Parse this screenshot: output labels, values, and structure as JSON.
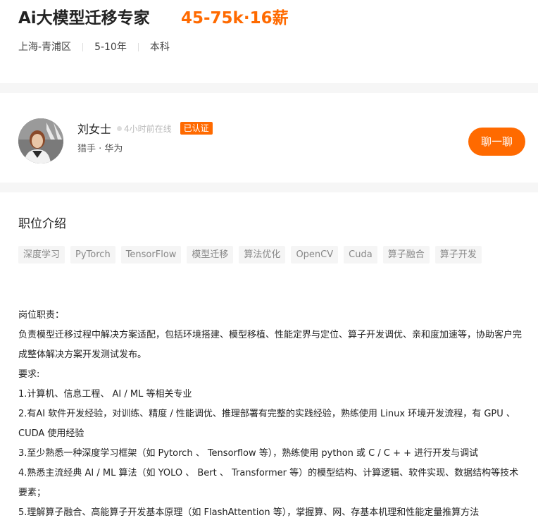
{
  "job": {
    "title": "Ai大模型迁移专家",
    "salary": "45-75k·16薪",
    "location": "上海-青浦区",
    "experience": "5-10年",
    "education": "本科"
  },
  "recruiter": {
    "name": "刘女士",
    "online_status": "4小时前在线",
    "verified_badge": "已认证",
    "role_company": "猎手 · 华为",
    "chat_button": "聊一聊"
  },
  "description": {
    "section_title": "职位介绍",
    "tags": [
      "深度学习",
      "PyTorch",
      "TensorFlow",
      "模型迁移",
      "算法优化",
      "OpenCV",
      "Cuda",
      "算子融合",
      "算子开发"
    ],
    "lines": [
      "岗位职责：",
      "负责模型迁移过程中解决方案适配，包括环境搭建、模型移植、性能定界与定位、算子开发调优、亲和度加速等，协助客户完成整体解决方案开发测试发布。",
      "要求:",
      "1.计算机、信息工程、 AI / ML 等相关专业",
      "2.有AI 软件开发经验，对训练、精度 / 性能调优、推理部署有完整的实践经验，熟练使用 Linux 环境开发流程，有 GPU 、 CUDA 使用经验",
      "3.至少熟悉一种深度学习框架（如 Pytorch 、 Tensorflow 等），熟练使用 python 或 C / C + + 进行开发与调试",
      "4.熟悉主流经典 AI / ML 算法（如 YOLO 、 Bert 、 Transformer 等）的模型结构、计算逻辑、软件实现、数据结构等技术要素；",
      "5.理解算子融合、高能算子开发基本原理（如 FlashAttention 等），掌握算、网、存基本机理和性能定量推算方法"
    ]
  },
  "colors": {
    "accent": "#ff6a00",
    "tag_bg": "#f5f5f5",
    "band": "#f6f6f6"
  },
  "icons": {
    "avatar": "recruiter-avatar",
    "online_dot": "online-dot-icon"
  }
}
